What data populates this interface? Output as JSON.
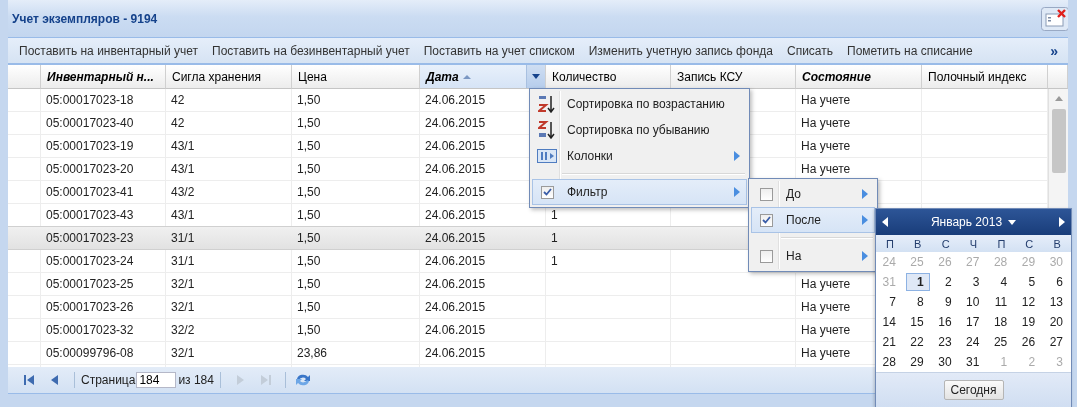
{
  "window": {
    "title": "Учет экземпляров - 9194"
  },
  "toolbar": {
    "buttons": [
      "Поставить на инвентарный учет",
      "Поставить на безинвентарный учет",
      "Поставить на учет списком",
      "Изменить учетную запись фонда",
      "Списать",
      "Пометить на списание"
    ],
    "overflow": "»"
  },
  "table": {
    "columns": [
      {
        "label": "Инвентарный н...",
        "filtered": true,
        "sorted": false,
        "menu_open": false
      },
      {
        "label": "Сигла хранения",
        "filtered": false,
        "sorted": false,
        "menu_open": false
      },
      {
        "label": "Цена",
        "filtered": false,
        "sorted": false,
        "menu_open": false
      },
      {
        "label": "Дата",
        "filtered": true,
        "sorted": true,
        "menu_open": true
      },
      {
        "label": "Количество",
        "filtered": false,
        "sorted": false,
        "menu_open": false
      },
      {
        "label": "Запись КСУ",
        "filtered": false,
        "sorted": false,
        "menu_open": false
      },
      {
        "label": "Состояние",
        "filtered": true,
        "sorted": false,
        "menu_open": false
      },
      {
        "label": "Полочный индекс",
        "filtered": false,
        "sorted": false,
        "menu_open": false
      }
    ],
    "rows": [
      {
        "selected": false,
        "cells": [
          "05:00017023-18",
          "42",
          "1,50",
          "24.06.2015",
          null,
          null,
          "На учете",
          null
        ]
      },
      {
        "selected": false,
        "cells": [
          "05:00017023-40",
          "42",
          "1,50",
          "24.06.2015",
          null,
          null,
          "На учете",
          null
        ]
      },
      {
        "selected": false,
        "cells": [
          "05:00017023-19",
          "43/1",
          "1,50",
          "24.06.2015",
          null,
          null,
          "На учете",
          null
        ]
      },
      {
        "selected": false,
        "cells": [
          "05:00017023-20",
          "43/1",
          "1,50",
          "24.06.2015",
          null,
          null,
          "На учете",
          null
        ]
      },
      {
        "selected": false,
        "cells": [
          "05:00017023-41",
          "43/2",
          "1,50",
          "24.06.2015",
          null,
          null,
          null,
          null
        ]
      },
      {
        "selected": false,
        "cells": [
          "05:00017023-43",
          "43/1",
          "1,50",
          "24.06.2015",
          "1",
          null,
          null,
          null
        ]
      },
      {
        "selected": true,
        "cells": [
          "05:00017023-23",
          "31/1",
          "1,50",
          "24.06.2015",
          "1",
          null,
          null,
          null
        ]
      },
      {
        "selected": false,
        "cells": [
          "05:00017023-24",
          "31/1",
          "1,50",
          "24.06.2015",
          "1",
          null,
          null,
          null
        ]
      },
      {
        "selected": false,
        "cells": [
          "05:00017023-25",
          "32/1",
          "1,50",
          "24.06.2015",
          null,
          null,
          "На учете",
          null
        ]
      },
      {
        "selected": false,
        "cells": [
          "05:00017023-26",
          "32/1",
          "1,50",
          "24.06.2015",
          null,
          null,
          "На учете",
          null
        ]
      },
      {
        "selected": false,
        "cells": [
          "05:00017023-32",
          "32/2",
          "1,50",
          "24.06.2015",
          null,
          null,
          "На учете",
          null
        ]
      },
      {
        "selected": false,
        "cells": [
          "05:00099796-08",
          "32/1",
          "23,86",
          "24.06.2015",
          null,
          null,
          "На учете",
          null
        ]
      }
    ]
  },
  "paging": {
    "nav": [
      {
        "kind": "first",
        "disabled": false
      },
      {
        "kind": "prev",
        "disabled": false
      },
      {
        "kind": "next",
        "disabled": true
      },
      {
        "kind": "last",
        "disabled": true
      }
    ],
    "page_label": "Страница",
    "page": "184",
    "total": "из 184"
  },
  "column_menu": {
    "items": [
      {
        "kind": "sort-asc",
        "label": "Сортировка по возрастанию",
        "submenu": false,
        "expanded": false
      },
      {
        "kind": "sort-desc",
        "label": "Сортировка по убыванию",
        "submenu": false,
        "expanded": false
      },
      {
        "kind": "columns",
        "label": "Колонки",
        "submenu": true,
        "expanded": false
      },
      {
        "kind": "separator"
      },
      {
        "kind": "check",
        "label": "Фильтр",
        "checked": true,
        "submenu": true,
        "expanded": true
      }
    ]
  },
  "filter_menu": {
    "items": [
      {
        "kind": "check",
        "label": "До",
        "checked": false,
        "submenu": true,
        "expanded": false
      },
      {
        "kind": "check",
        "label": "После",
        "checked": true,
        "submenu": true,
        "expanded": true
      },
      {
        "kind": "separator"
      },
      {
        "kind": "check",
        "label": "На",
        "checked": false,
        "submenu": true,
        "expanded": false
      }
    ]
  },
  "date_picker": {
    "month": "Январь 2013",
    "weekdays": [
      "П",
      "В",
      "С",
      "Ч",
      "П",
      "С",
      "В"
    ],
    "days": [
      {
        "label": "24",
        "other": true,
        "selected": false
      },
      {
        "label": "25",
        "other": true,
        "selected": false
      },
      {
        "label": "26",
        "other": true,
        "selected": false
      },
      {
        "label": "27",
        "other": true,
        "selected": false
      },
      {
        "label": "28",
        "other": true,
        "selected": false
      },
      {
        "label": "29",
        "other": true,
        "selected": false
      },
      {
        "label": "30",
        "other": true,
        "selected": false
      },
      {
        "label": "31",
        "other": true,
        "selected": false
      },
      {
        "label": "1",
        "other": false,
        "selected": true
      },
      {
        "label": "2",
        "other": false,
        "selected": false
      },
      {
        "label": "3",
        "other": false,
        "selected": false
      },
      {
        "label": "4",
        "other": false,
        "selected": false
      },
      {
        "label": "5",
        "other": false,
        "selected": false
      },
      {
        "label": "6",
        "other": false,
        "selected": false
      },
      {
        "label": "7",
        "other": false,
        "selected": false
      },
      {
        "label": "8",
        "other": false,
        "selected": false
      },
      {
        "label": "9",
        "other": false,
        "selected": false
      },
      {
        "label": "10",
        "other": false,
        "selected": false
      },
      {
        "label": "11",
        "other": false,
        "selected": false
      },
      {
        "label": "12",
        "other": false,
        "selected": false
      },
      {
        "label": "13",
        "other": false,
        "selected": false
      },
      {
        "label": "14",
        "other": false,
        "selected": false
      },
      {
        "label": "15",
        "other": false,
        "selected": false
      },
      {
        "label": "16",
        "other": false,
        "selected": false
      },
      {
        "label": "17",
        "other": false,
        "selected": false
      },
      {
        "label": "18",
        "other": false,
        "selected": false
      },
      {
        "label": "19",
        "other": false,
        "selected": false
      },
      {
        "label": "20",
        "other": false,
        "selected": false
      },
      {
        "label": "21",
        "other": false,
        "selected": false
      },
      {
        "label": "22",
        "other": false,
        "selected": false
      },
      {
        "label": "23",
        "other": false,
        "selected": false
      },
      {
        "label": "24",
        "other": false,
        "selected": false
      },
      {
        "label": "25",
        "other": false,
        "selected": false
      },
      {
        "label": "26",
        "other": false,
        "selected": false
      },
      {
        "label": "27",
        "other": false,
        "selected": false
      },
      {
        "label": "28",
        "other": false,
        "selected": false
      },
      {
        "label": "29",
        "other": false,
        "selected": false
      },
      {
        "label": "30",
        "other": false,
        "selected": false
      },
      {
        "label": "31",
        "other": false,
        "selected": false
      },
      {
        "label": "1",
        "other": true,
        "selected": false
      },
      {
        "label": "2",
        "other": true,
        "selected": false
      },
      {
        "label": "3",
        "other": true,
        "selected": false
      }
    ],
    "today_button": "Сегодня"
  }
}
